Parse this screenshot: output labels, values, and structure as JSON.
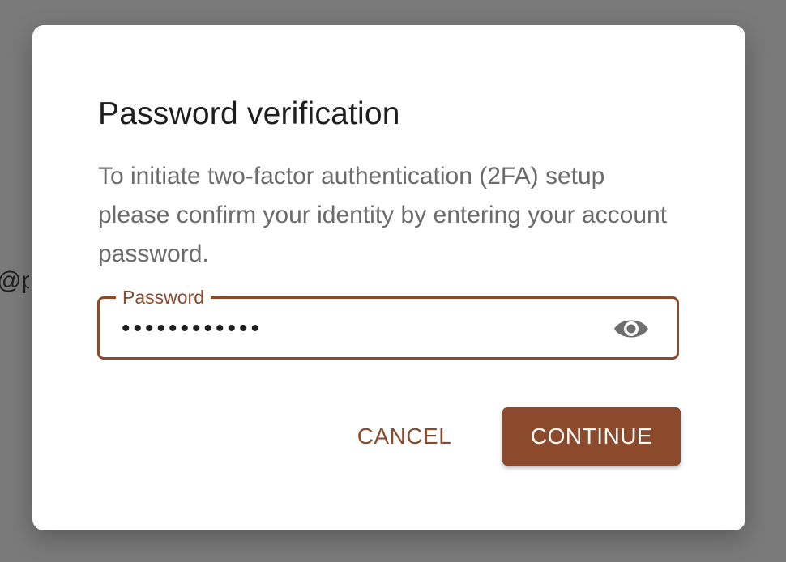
{
  "background": {
    "fragment_text": "@pa"
  },
  "dialog": {
    "title": "Password verification",
    "description": "To initiate two-factor authentication (2FA) setup please confirm your identity by entering your account password.",
    "password_field": {
      "label": "Password",
      "value_masked": "••••••••••••",
      "toggle_icon": "eye-icon"
    },
    "cancel_label": "CANCEL",
    "continue_label": "CONTINUE"
  },
  "colors": {
    "accent": "#8b4a2b",
    "backdrop": "#7a7a7a",
    "dialog_bg": "#ffffff"
  }
}
